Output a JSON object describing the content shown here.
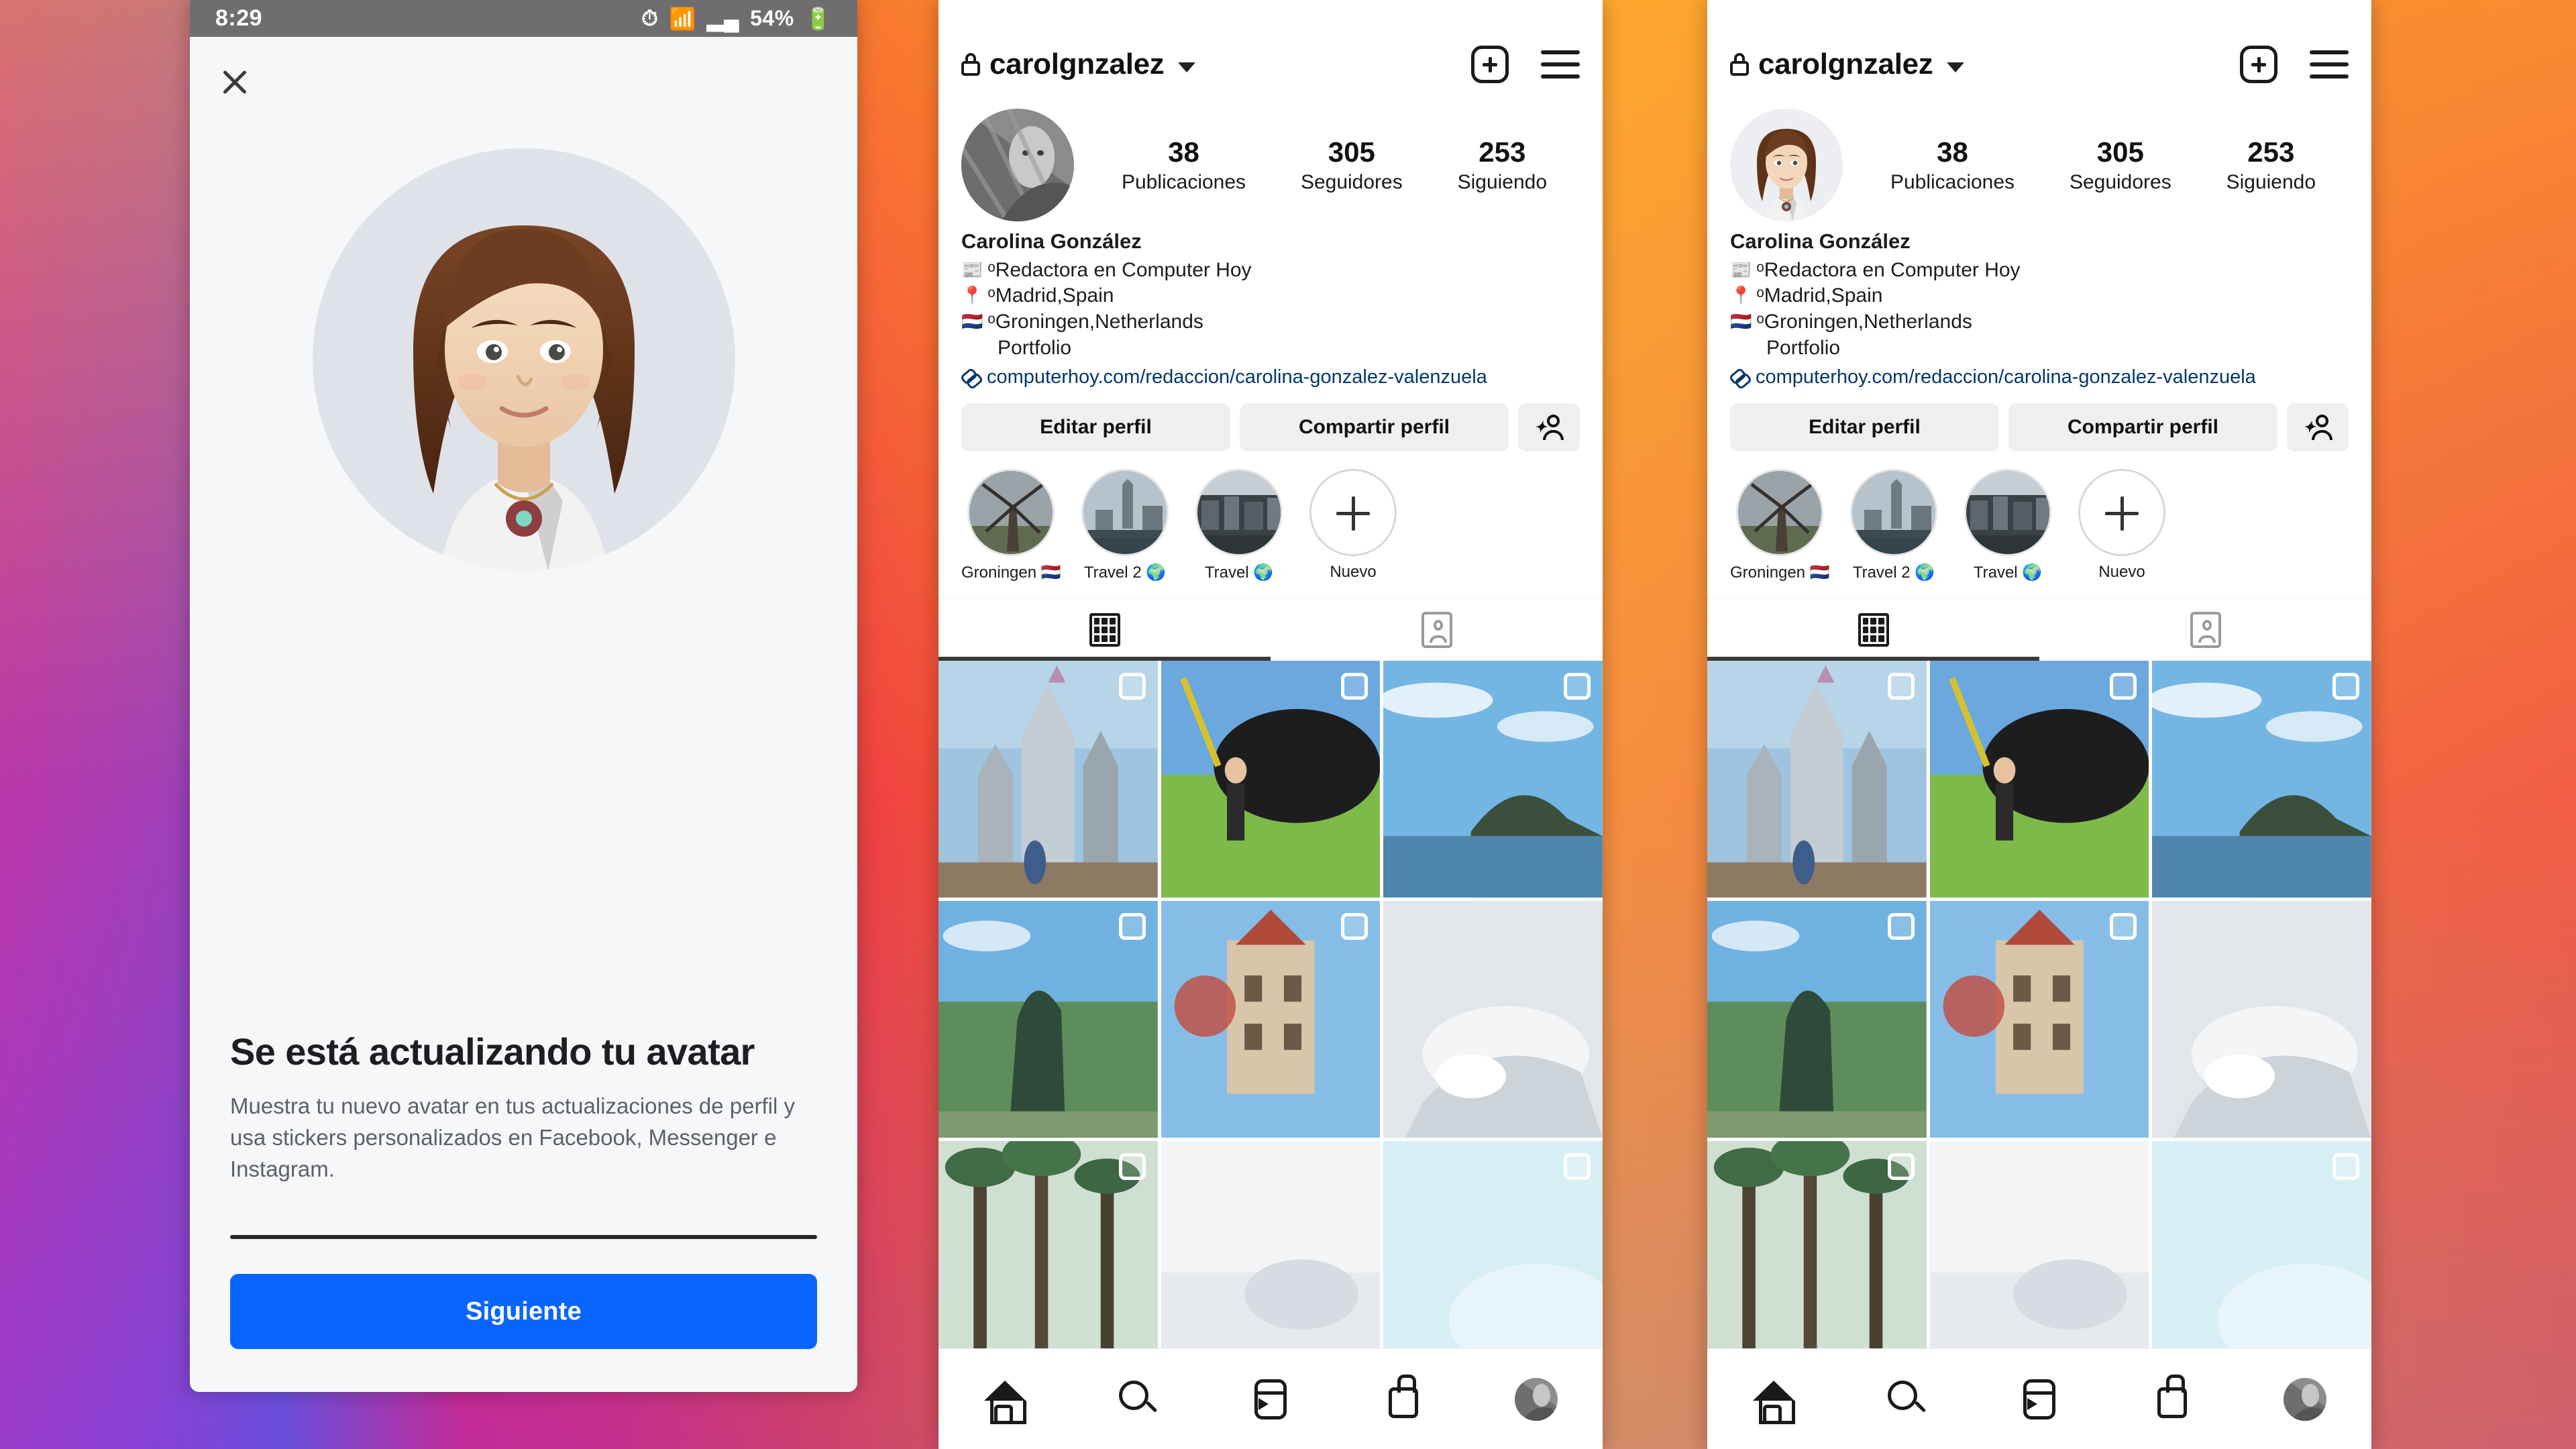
{
  "background": {
    "description": "instagram-gradient",
    "colors": [
      "#6257dd",
      "#a93bc4",
      "#e0237c",
      "#ef3f42",
      "#f87c25",
      "#fbb335"
    ]
  },
  "phone1": {
    "statusbar": {
      "time": "8:29",
      "battery": "54%",
      "icons": [
        "alarm-icon",
        "wifi-icon",
        "signal-icon",
        "battery-icon"
      ]
    },
    "close_label": "×",
    "avatar_alt": "avatar-preview",
    "title": "Se está actualizando tu avatar",
    "subtitle": "Muestra tu nuevo avatar en tus actualizaciones de perfil y usa stickers personalizados en Facebook, Messenger e Instagram.",
    "primary_button": "Siguiente",
    "accent_color": "#0866ff"
  },
  "profile": {
    "header": {
      "username": "carolgnzalez",
      "lock_icon": "lock-icon",
      "chevron_icon": "chevron-down-icon",
      "add_icon": "plus-square-icon",
      "menu_icon": "hamburger-menu-icon"
    },
    "stats": [
      {
        "num": "38",
        "label": "Publicaciones"
      },
      {
        "num": "305",
        "label": "Seguidores"
      },
      {
        "num": "253",
        "label": "Siguiendo"
      }
    ],
    "bio": {
      "name": "Carolina González",
      "lines": [
        {
          "emoji": "📰",
          "text": "ᵒRedactora en Computer Hoy"
        },
        {
          "emoji": "📍",
          "text": "ᵒMadrid,Spain"
        },
        {
          "emoji": "🇳🇱",
          "text": "ᵒGroningen,Netherlands"
        }
      ],
      "indent_line": "Portfolio",
      "link": "computerhoy.com/redaccion/carolina-gonzalez-valenzuela",
      "link_color": "#00376b"
    },
    "actions": {
      "edit": "Editar perfil",
      "share": "Compartir perfil",
      "add_person_icon": "add-person-icon"
    },
    "highlights": [
      {
        "label": "Groningen 🇳🇱",
        "thumb": "windmill"
      },
      {
        "label": "Travel 2 🌍",
        "thumb": "city-tower"
      },
      {
        "label": "Travel 🌍",
        "thumb": "canal"
      },
      {
        "label": "Nuevo",
        "thumb": "plus"
      }
    ],
    "tabs": [
      {
        "icon": "grid-icon",
        "active": true
      },
      {
        "icon": "tagged-person-icon",
        "active": false
      }
    ],
    "posts": [
      {
        "alt": "castle",
        "carousel": true
      },
      {
        "alt": "festival-stage",
        "carousel": true
      },
      {
        "alt": "beach-bay",
        "carousel": true
      },
      {
        "alt": "coast-viewpoint",
        "carousel": true
      },
      {
        "alt": "carnival-ride",
        "carousel": true
      },
      {
        "alt": "white-architecture",
        "carousel": false
      },
      {
        "alt": "palm-trees",
        "carousel": true
      },
      {
        "alt": "snow-scene",
        "carousel": false
      },
      {
        "alt": "pale-sky",
        "carousel": true
      }
    ],
    "bottomnav": [
      {
        "icon": "home-icon"
      },
      {
        "icon": "search-icon"
      },
      {
        "icon": "reels-icon"
      },
      {
        "icon": "shop-icon"
      },
      {
        "icon": "profile-avatar-icon"
      }
    ]
  }
}
